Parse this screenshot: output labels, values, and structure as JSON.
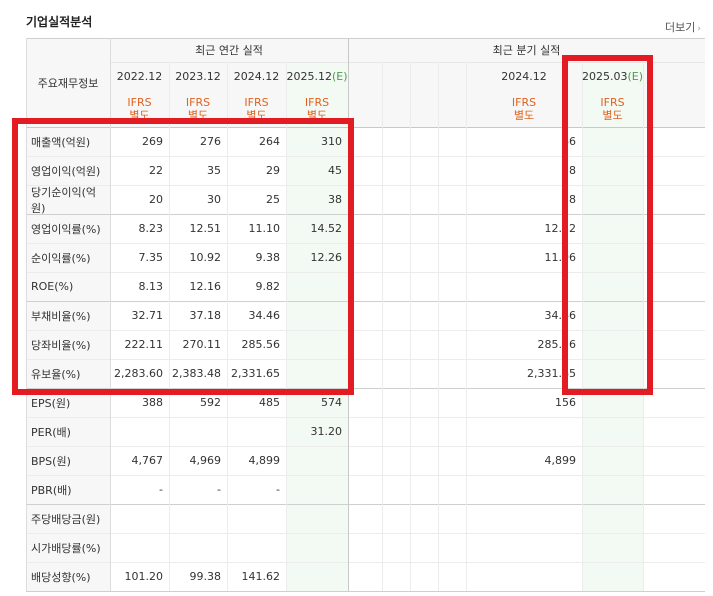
{
  "title": "기업실적분석",
  "more_label": "더보기",
  "header": {
    "row_label": "주요재무정보",
    "annual_title": "최근 연간 실적",
    "quarter_title": "최근 분기 실적"
  },
  "annual_periods": [
    {
      "date": "2022.12",
      "est": "",
      "std1": "IFRS",
      "std2": "별도"
    },
    {
      "date": "2023.12",
      "est": "",
      "std1": "IFRS",
      "std2": "별도"
    },
    {
      "date": "2024.12",
      "est": "",
      "std1": "IFRS",
      "std2": "별도"
    },
    {
      "date": "2025.12",
      "est": "(E)",
      "std1": "IFRS",
      "std2": "별도"
    }
  ],
  "quarter_periods": [
    {
      "date": "",
      "est": "",
      "std1": "",
      "std2": ""
    },
    {
      "date": "",
      "est": "",
      "std1": "",
      "std2": ""
    },
    {
      "date": "",
      "est": "",
      "std1": "",
      "std2": ""
    },
    {
      "date": "",
      "est": "",
      "std1": "",
      "std2": ""
    },
    {
      "date": "2024.12",
      "est": "",
      "std1": "IFRS",
      "std2": "별도"
    },
    {
      "date": "2025.03",
      "est": "(E)",
      "std1": "IFRS",
      "std2": "별도"
    }
  ],
  "rows": [
    {
      "label": "매출액(억원)",
      "annual": [
        "269",
        "276",
        "264",
        "310"
      ],
      "quarter": [
        "",
        "",
        "",
        "",
        "66",
        ""
      ]
    },
    {
      "label": "영업이익(억원)",
      "annual": [
        "22",
        "35",
        "29",
        "45"
      ],
      "quarter": [
        "",
        "",
        "",
        "",
        "8",
        ""
      ]
    },
    {
      "label": "당기순이익(억원)",
      "annual": [
        "20",
        "30",
        "25",
        "38"
      ],
      "quarter": [
        "",
        "",
        "",
        "",
        "8",
        ""
      ]
    },
    {
      "label": "영업이익률(%)",
      "annual": [
        "8.23",
        "12.51",
        "11.10",
        "14.52"
      ],
      "quarter": [
        "",
        "",
        "",
        "",
        "12.32",
        ""
      ]
    },
    {
      "label": "순이익률(%)",
      "annual": [
        "7.35",
        "10.92",
        "9.38",
        "12.26"
      ],
      "quarter": [
        "",
        "",
        "",
        "",
        "11.96",
        ""
      ]
    },
    {
      "label": "ROE(%)",
      "annual": [
        "8.13",
        "12.16",
        "9.82",
        ""
      ],
      "quarter": [
        "",
        "",
        "",
        "",
        "",
        ""
      ]
    },
    {
      "label": "부채비율(%)",
      "annual": [
        "32.71",
        "37.18",
        "34.46",
        ""
      ],
      "quarter": [
        "",
        "",
        "",
        "",
        "34.46",
        ""
      ]
    },
    {
      "label": "당좌비율(%)",
      "annual": [
        "222.11",
        "270.11",
        "285.56",
        ""
      ],
      "quarter": [
        "",
        "",
        "",
        "",
        "285.56",
        ""
      ]
    },
    {
      "label": "유보율(%)",
      "annual": [
        "2,283.60",
        "2,383.48",
        "2,331.65",
        ""
      ],
      "quarter": [
        "",
        "",
        "",
        "",
        "2,331.65",
        ""
      ]
    },
    {
      "label": "EPS(원)",
      "annual": [
        "388",
        "592",
        "485",
        "574"
      ],
      "quarter": [
        "",
        "",
        "",
        "",
        "156",
        ""
      ]
    },
    {
      "label": "PER(배)",
      "annual": [
        "",
        "",
        "",
        "31.20"
      ],
      "quarter": [
        "",
        "",
        "",
        "",
        "",
        ""
      ]
    },
    {
      "label": "BPS(원)",
      "annual": [
        "4,767",
        "4,969",
        "4,899",
        ""
      ],
      "quarter": [
        "",
        "",
        "",
        "",
        "4,899",
        ""
      ]
    },
    {
      "label": "PBR(배)",
      "annual": [
        "-",
        "-",
        "-",
        ""
      ],
      "quarter": [
        "",
        "",
        "",
        "",
        "",
        ""
      ]
    },
    {
      "label": "주당배당금(원)",
      "annual": [
        "",
        "",
        "",
        ""
      ],
      "quarter": [
        "",
        "",
        "",
        "",
        "",
        ""
      ]
    },
    {
      "label": "시가배당률(%)",
      "annual": [
        "",
        "",
        "",
        ""
      ],
      "quarter": [
        "",
        "",
        "",
        "",
        "",
        ""
      ]
    },
    {
      "label": "배당성향(%)",
      "annual": [
        "101.20",
        "99.38",
        "141.62",
        ""
      ],
      "quarter": [
        "",
        "",
        "",
        "",
        "",
        ""
      ]
    }
  ],
  "colors": {
    "header_bg": "#f7f7f7",
    "estimate_bg": "#f3f9f3",
    "ifrs_orange": "#e0621f",
    "estimate_green": "#4a9c4a",
    "highlight_red": "#e31b23"
  }
}
